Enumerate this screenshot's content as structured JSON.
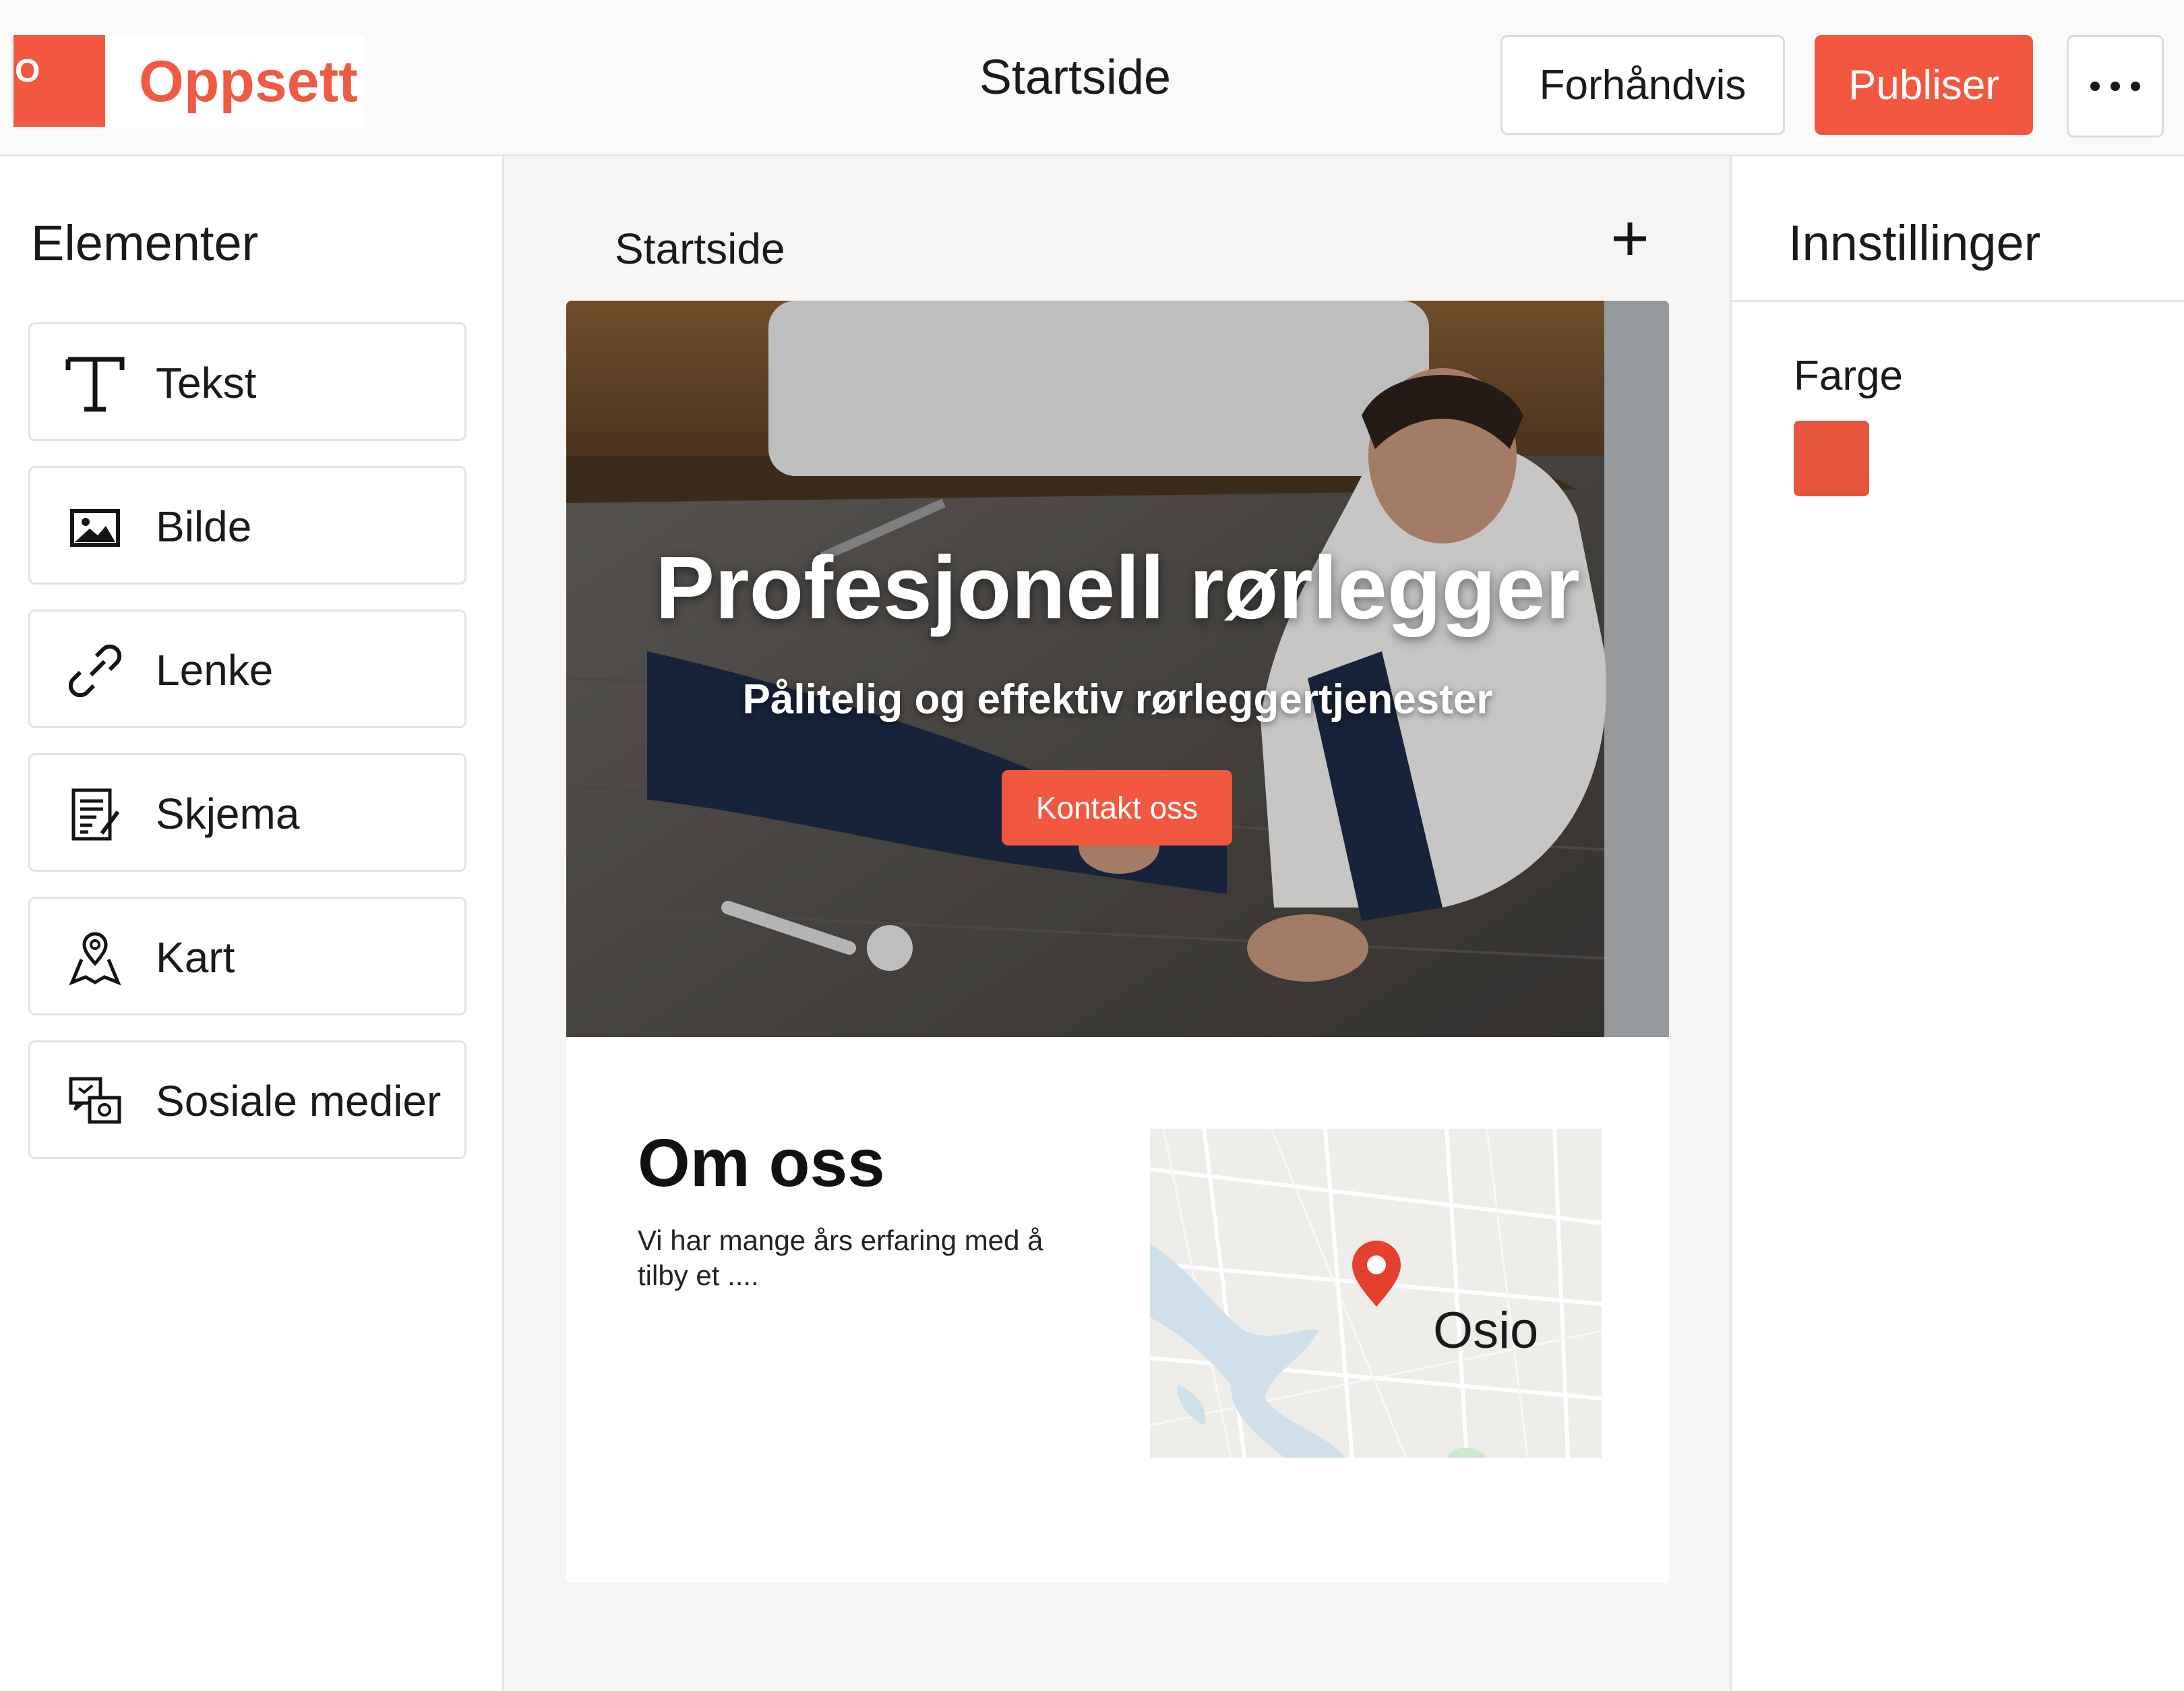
{
  "header": {
    "logo_letter": "O",
    "logo_text": "Oppsett",
    "document_title": "Startside",
    "preview_label": "Forhåndvis",
    "publish_label": "Publiser",
    "more_label": "•••"
  },
  "sidebar": {
    "title": "Elementer",
    "items": [
      {
        "label": "Tekst",
        "icon": "text-icon"
      },
      {
        "label": "Bilde",
        "icon": "image-icon"
      },
      {
        "label": "Lenke",
        "icon": "link-icon"
      },
      {
        "label": "Skjema",
        "icon": "form-icon"
      },
      {
        "label": "Kart",
        "icon": "map-icon"
      },
      {
        "label": "Sosiale medier",
        "icon": "social-media-icon"
      }
    ]
  },
  "canvas": {
    "page_tab": "Startside",
    "add_page_label": "+",
    "hero": {
      "title": "Profesjonell rørlegger",
      "subtitle": "Pålitelig og effektiv rørleggertjenester",
      "button_label": "Kontakt oss"
    },
    "about": {
      "title": "Om oss",
      "text": "Vi har mange års erfaring med å tilby et ...."
    },
    "map": {
      "label": "Osio"
    }
  },
  "settings": {
    "title": "Innstillinger",
    "color_label": "Farge",
    "color_value": "#e5553d"
  },
  "colors": {
    "accent": "#f2573f",
    "logo_text": "#ef5a45",
    "canvas_bg": "#f6f5f3"
  }
}
